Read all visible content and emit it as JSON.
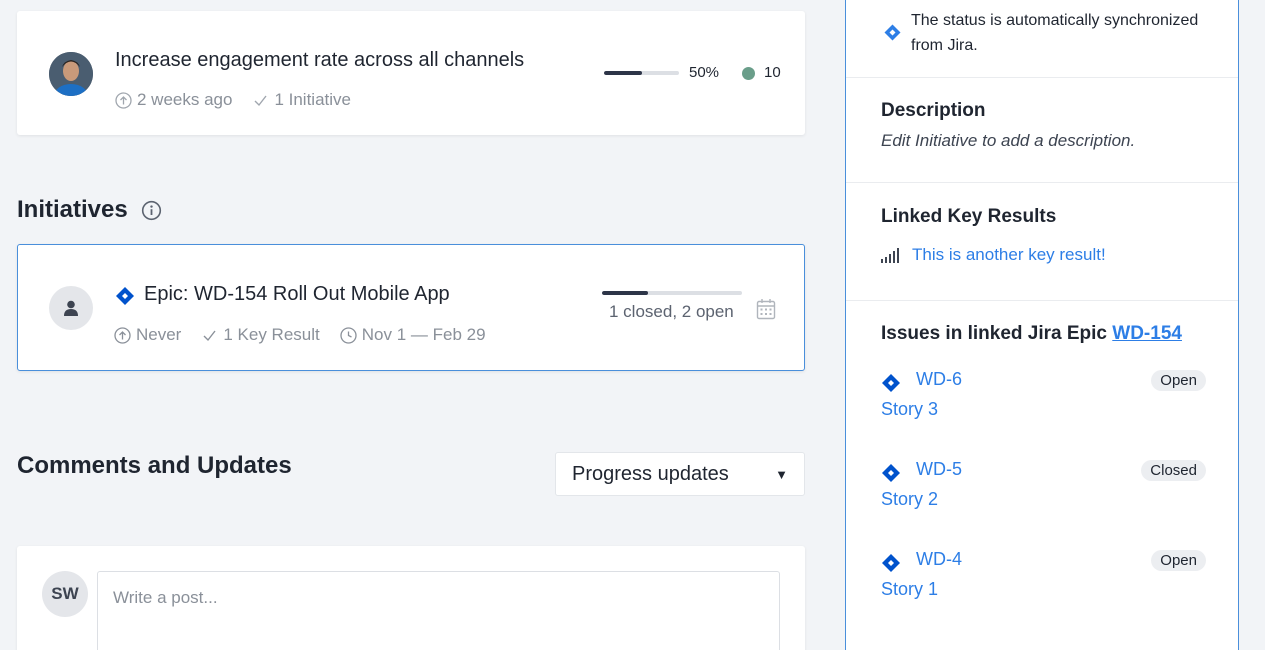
{
  "goal": {
    "title": "Increase engagement rate across all channels",
    "updated": "2 weeks ago",
    "initiatives": "1 Initiative",
    "progress_fraction": 0.5,
    "progress_label": "50%",
    "score": "10"
  },
  "initiatives_section": {
    "title": "Initiatives"
  },
  "initiative": {
    "title": "Epic: WD-154 Roll Out Mobile App",
    "updated": "Never",
    "key_results": "1 Key Result",
    "dates": "Nov 1 — Feb 29",
    "progress_fraction": 0.33,
    "status": "1 closed, 2 open"
  },
  "comments": {
    "title": "Comments and Updates",
    "filter_selected": "Progress updates",
    "user_initials": "SW",
    "post_placeholder": "Write a post..."
  },
  "side_panel": {
    "sync_notice": "The status is automatically synchronized from Jira.",
    "description_heading": "Description",
    "description_text": "Edit Initiative to add a description.",
    "linked_kr_heading": "Linked Key Results",
    "linked_kr": "This is another key result!",
    "issues_heading": "Issues in linked Jira Epic",
    "epic_key": "WD-154",
    "issues": [
      {
        "key": "WD-6",
        "summary": "Story 3",
        "status": "Open"
      },
      {
        "key": "WD-5",
        "summary": "Story 2",
        "status": "Closed"
      },
      {
        "key": "WD-4",
        "summary": "Story 1",
        "status": "Open"
      }
    ]
  },
  "colors": {
    "accent": "#2d7ee6",
    "jira_blue": "#0052cc",
    "progress_dark": "#2d3548",
    "score_dot": "#6a9e8a"
  }
}
